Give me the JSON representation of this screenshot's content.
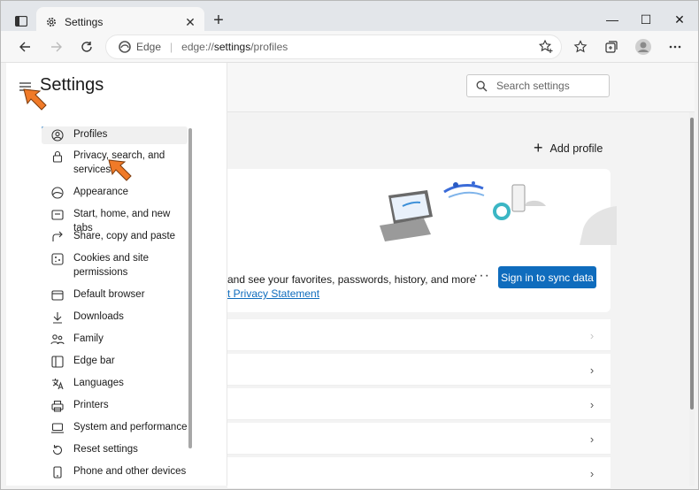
{
  "window": {
    "tab_title": "Settings",
    "minimize": "—",
    "maximize": "☐",
    "close": "✕"
  },
  "toolbar": {
    "site_name": "Edge",
    "url_scheme": "edge://",
    "url_host": "settings",
    "url_path": "/profiles"
  },
  "sidebar": {
    "title": "Settings",
    "items": [
      {
        "label": "Profiles",
        "icon": "profile-icon"
      },
      {
        "label": "Privacy, search, and services",
        "icon": "lock-icon"
      },
      {
        "label": "Appearance",
        "icon": "appearance-icon"
      },
      {
        "label": "Start, home, and new tabs",
        "icon": "power-icon"
      },
      {
        "label": "Share, copy and paste",
        "icon": "share-icon"
      },
      {
        "label": "Cookies and site permissions",
        "icon": "cookies-icon"
      },
      {
        "label": "Default browser",
        "icon": "browser-icon"
      },
      {
        "label": "Downloads",
        "icon": "download-icon"
      },
      {
        "label": "Family",
        "icon": "family-icon"
      },
      {
        "label": "Edge bar",
        "icon": "edge-bar-icon"
      },
      {
        "label": "Languages",
        "icon": "language-icon"
      },
      {
        "label": "Printers",
        "icon": "printer-icon"
      },
      {
        "label": "System and performance",
        "icon": "laptop-icon"
      },
      {
        "label": "Reset settings",
        "icon": "reset-icon"
      },
      {
        "label": "Phone and other devices",
        "icon": "phone-icon"
      }
    ]
  },
  "main": {
    "search_placeholder": "Search settings",
    "add_profile": "Add profile",
    "card": {
      "description": "and see your favorites, passwords, history, and more",
      "link": "t Privacy Statement",
      "more": "···",
      "sync_button": "Sign in to sync data"
    }
  },
  "colors": {
    "accent": "#0f6cbd",
    "annotation_arrow": "#f07a28"
  }
}
